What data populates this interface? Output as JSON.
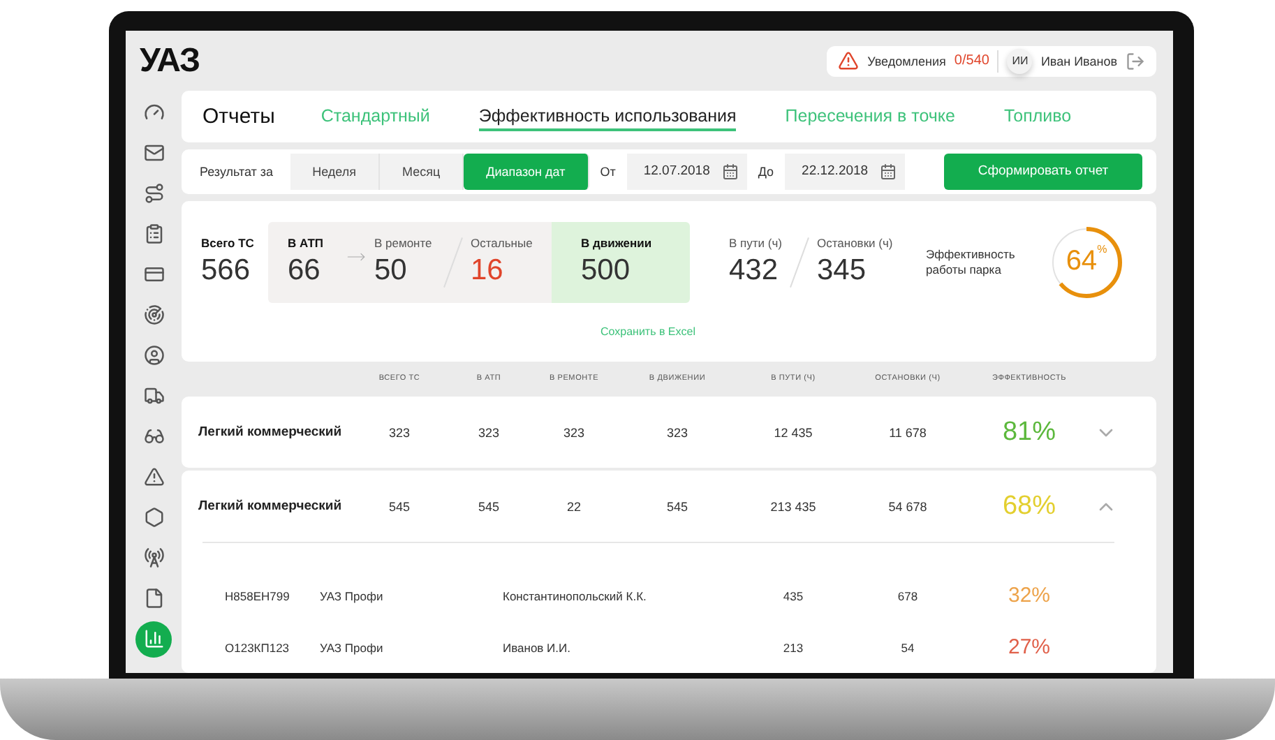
{
  "header": {
    "logo": "УАЗ",
    "notifications": {
      "label": "Уведомления",
      "count": "0/540"
    },
    "user": {
      "initials": "ИИ",
      "name": "Иван Иванов"
    }
  },
  "sidebar": {
    "items": [
      {
        "selected": false
      },
      {
        "selected": false
      },
      {
        "selected": false
      },
      {
        "selected": false
      },
      {
        "selected": false
      },
      {
        "selected": false
      },
      {
        "selected": false
      },
      {
        "selected": false
      },
      {
        "selected": false
      },
      {
        "selected": false
      },
      {
        "selected": false
      },
      {
        "selected": false
      },
      {
        "selected": false
      },
      {
        "selected": true
      }
    ]
  },
  "tabs": {
    "title": "Отчеты",
    "items": [
      {
        "label": "Стандартный",
        "selected": false
      },
      {
        "label": "Эффективность использования",
        "selected": true
      },
      {
        "label": "Пересечения в точке",
        "selected": false
      },
      {
        "label": "Топливо",
        "selected": false
      }
    ]
  },
  "filter": {
    "label": "Результат за",
    "periods": [
      {
        "label": "Неделя",
        "selected": false
      },
      {
        "label": "Месяц",
        "selected": false
      },
      {
        "label": "Диапазон дат",
        "selected": true
      }
    ],
    "from": {
      "label": "От",
      "value": "12.07.2018"
    },
    "to": {
      "label": "До",
      "value": "22.12.2018"
    },
    "submit": "Сформировать отчет"
  },
  "summary": {
    "total": {
      "label": "Всего ТС",
      "value": "566"
    },
    "depot": {
      "label": "В АТП",
      "value": "66"
    },
    "repair": {
      "label": "В ремонте",
      "value": "50"
    },
    "other": {
      "label": "Остальные",
      "value": "16"
    },
    "moving": {
      "label": "В движении",
      "value": "500"
    },
    "on_road": {
      "label": "В пути (ч)",
      "value": "432"
    },
    "stops": {
      "label": "Остановки (ч)",
      "value": "345"
    },
    "efficiency": {
      "label": "Эффективность работы парка",
      "value": "64",
      "unit": "%",
      "level": 0.64
    },
    "export": "Сохранить в Excel"
  },
  "table": {
    "columns": [
      "ВСЕГО ТС",
      "В АТП",
      "В РЕМОНТЕ",
      "В ДВИЖЕНИИ",
      "В ПУТИ (Ч)",
      "ОСТАНОВКИ (Ч)",
      "ЭФФЕКТИВНОСТЬ"
    ],
    "rows": [
      {
        "name": "Легкий коммерческий",
        "values": [
          "323",
          "323",
          "323",
          "323",
          "12 435",
          "11 678"
        ],
        "efficiency": "81%",
        "color": "#5cb83c",
        "expanded": false,
        "children": []
      },
      {
        "name": "Легкий коммерческий",
        "values": [
          "545",
          "545",
          "22",
          "545",
          "213 435",
          "54 678"
        ],
        "efficiency": "68%",
        "color": "#e3cf2f",
        "expanded": true,
        "children": [
          {
            "plate": "Н858ЕН799",
            "model": "УАЗ Профи",
            "driver": "Константинопольский К.К.",
            "on_road": "435",
            "stops": "678",
            "efficiency": "32%",
            "color": "#eda34a"
          },
          {
            "plate": "О123КП123",
            "model": "УАЗ Профи",
            "driver": "Иванов И.И.",
            "on_road": "213",
            "stops": "54",
            "efficiency": "27%",
            "color": "#e0604a"
          }
        ]
      }
    ]
  }
}
